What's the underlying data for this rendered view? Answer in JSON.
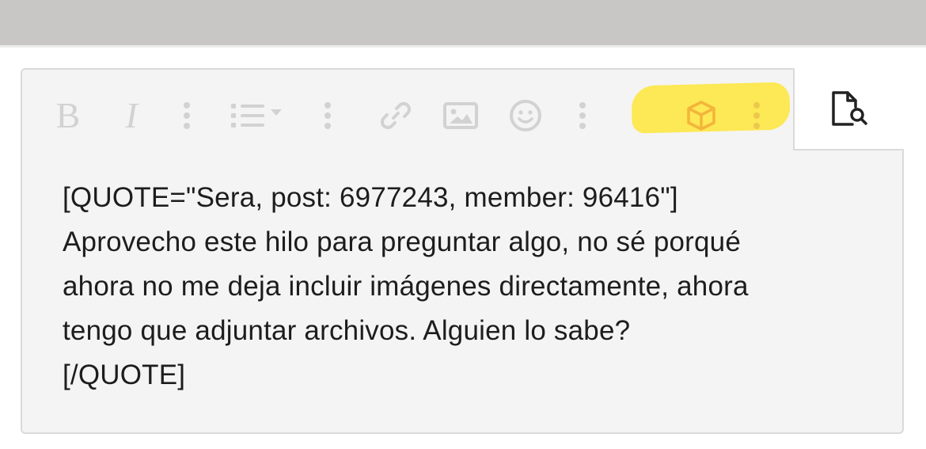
{
  "colors": {
    "topbar": "#c9c6c6",
    "editor_background": "#f4f4f4",
    "editor_border": "#dadada",
    "toolbar_icon": "#d2d2d2",
    "highlight": "#fde74c",
    "highlight_icon": "#f3b53a",
    "text": "#1d1d1d"
  },
  "toolbar": {
    "buttons": [
      {
        "name": "bold",
        "icon": "bold-icon",
        "label": "B"
      },
      {
        "name": "italic",
        "icon": "italic-icon",
        "label": "I"
      },
      {
        "name": "more-text-options",
        "icon": "vertical-ellipsis-icon"
      },
      {
        "name": "list",
        "icon": "list-dropdown-icon"
      },
      {
        "name": "more-paragraph-options",
        "icon": "vertical-ellipsis-icon"
      },
      {
        "name": "insert-link",
        "icon": "link-icon"
      },
      {
        "name": "insert-image",
        "icon": "image-icon"
      },
      {
        "name": "smilies",
        "icon": "smile-icon"
      },
      {
        "name": "more-insert-options",
        "icon": "vertical-ellipsis-icon"
      },
      {
        "name": "media",
        "icon": "cube-icon"
      },
      {
        "name": "more-options",
        "icon": "vertical-ellipsis-icon"
      }
    ],
    "preview_icon": "file-search-icon"
  },
  "editor": {
    "lines": [
      "[QUOTE=\"Sera, post: 6977243, member: 96416\"]",
      "Aprovecho este hilo para preguntar algo, no sé porqué",
      "ahora no me deja incluir imágenes directamente, ahora",
      "tengo que adjuntar archivos. Alguien lo sabe?",
      "[/QUOTE]"
    ]
  }
}
